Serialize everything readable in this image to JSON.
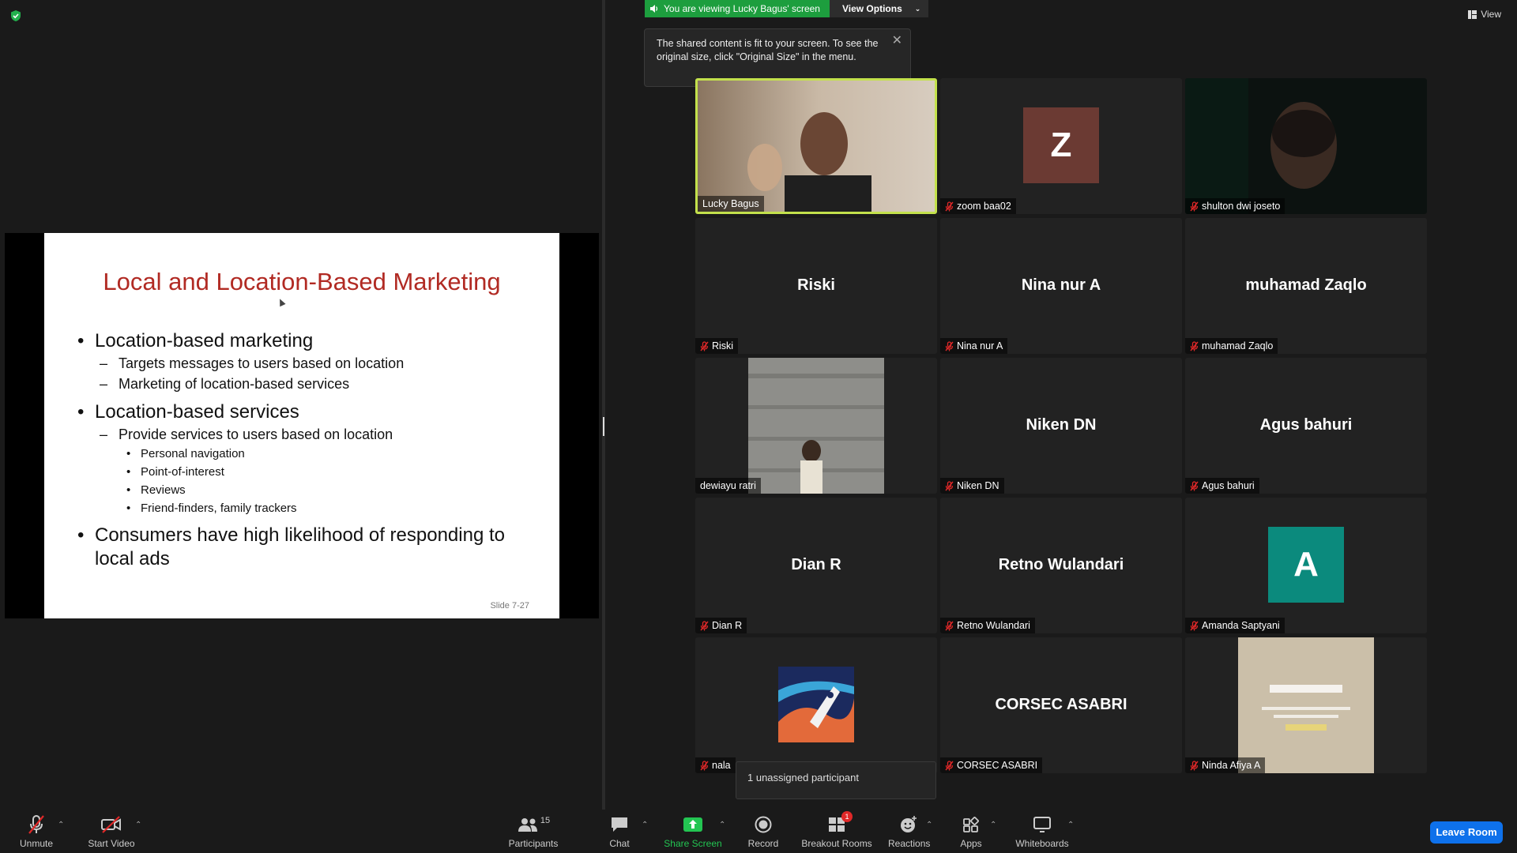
{
  "share_banner": {
    "viewing_text": "You are viewing Lucky Bagus' screen",
    "view_options": "View Options"
  },
  "tooltip": {
    "text": "The shared content is fit to your screen. To see the original size, click \"Original Size\" in the menu."
  },
  "view_button": "View",
  "slide": {
    "title": "Local and Location-Based Marketing",
    "items": [
      {
        "level": 1,
        "text": "Location-based marketing"
      },
      {
        "level": 2,
        "text": "Targets messages to users based on location"
      },
      {
        "level": 2,
        "text": "Marketing of location-based services"
      },
      {
        "level": 1,
        "text": "Location-based services"
      },
      {
        "level": 2,
        "text": "Provide services to users based on location"
      },
      {
        "level": 3,
        "text": "Personal navigation"
      },
      {
        "level": 3,
        "text": "Point-of-interest"
      },
      {
        "level": 3,
        "text": "Reviews"
      },
      {
        "level": 3,
        "text": "Friend-finders, family trackers"
      },
      {
        "level": 1,
        "text": "Consumers have high likelihood of responding to local ads"
      }
    ],
    "slide_number": "Slide 7-27"
  },
  "participants": [
    {
      "name": "Lucky Bagus",
      "muted": false,
      "kind": "video",
      "active": true
    },
    {
      "name": "zoom baa02",
      "muted": true,
      "kind": "avatar",
      "avatar_letter": "Z",
      "avatar_color": "#6b3a33"
    },
    {
      "name": "shulton dwi joseto",
      "muted": true,
      "kind": "video"
    },
    {
      "name": "Riski",
      "muted": true,
      "kind": "name",
      "display_name": "Riski"
    },
    {
      "name": "Nina nur A",
      "muted": true,
      "kind": "name",
      "display_name": "Nina nur A"
    },
    {
      "name": "muhamad Zaqlo",
      "muted": true,
      "kind": "name",
      "display_name": "muhamad Zaqlo"
    },
    {
      "name": "dewiayu ratri",
      "muted": false,
      "kind": "photo"
    },
    {
      "name": "Niken DN",
      "muted": true,
      "kind": "name",
      "display_name": "Niken DN"
    },
    {
      "name": "Agus bahuri",
      "muted": true,
      "kind": "name",
      "display_name": "Agus bahuri"
    },
    {
      "name": "Dian R",
      "muted": true,
      "kind": "name",
      "display_name": "Dian R"
    },
    {
      "name": "Retno Wulandari",
      "muted": true,
      "kind": "name",
      "display_name": "Retno Wulandari"
    },
    {
      "name": "Amanda Saptyani",
      "muted": true,
      "kind": "avatar",
      "avatar_letter": "A",
      "avatar_color": "#0b8a7d"
    },
    {
      "name": "nala",
      "muted": true,
      "kind": "art"
    },
    {
      "name": "CORSEC ASABRI",
      "muted": true,
      "kind": "name",
      "display_name": "CORSEC ASABRI"
    },
    {
      "name": "Ninda Afiya A",
      "muted": true,
      "kind": "quote"
    }
  ],
  "unassigned_popup": "1 unassigned participant",
  "toolbar": {
    "unmute": "Unmute",
    "start_video": "Start Video",
    "participants": "Participants",
    "participants_count": "15",
    "chat": "Chat",
    "share_screen": "Share Screen",
    "record": "Record",
    "breakout_rooms": "Breakout Rooms",
    "breakout_badge": "1",
    "reactions": "Reactions",
    "apps": "Apps",
    "whiteboards": "Whiteboards",
    "leave_room": "Leave Room"
  },
  "colors": {
    "banner_green": "#1d9e3e",
    "active_speaker": "#c3e14c",
    "leave_blue": "#0e71eb",
    "slide_title": "#b12a23"
  }
}
